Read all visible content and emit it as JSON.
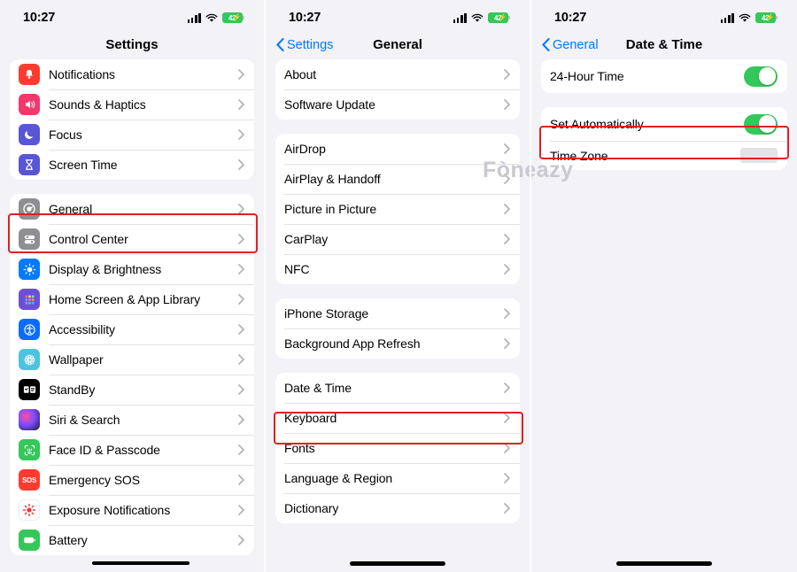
{
  "status": {
    "time": "10:27",
    "battery_percent": "42",
    "battery_color": "#34C759",
    "icons": {
      "signal": "cellular-signal-icon",
      "wifi": "wifi-icon",
      "battery": "battery-icon"
    }
  },
  "watermark": {
    "text": "Fòneazy"
  },
  "accent": {
    "blue": "#007AFF",
    "green": "#34C759",
    "highlight_red": "#E02020"
  },
  "panels": [
    {
      "id": "settings",
      "nav": {
        "back": "",
        "title": "Settings"
      },
      "groups": [
        {
          "rows": [
            {
              "label": "Notifications",
              "icon": "notifications-bell-icon",
              "color": "#FF3B30"
            },
            {
              "label": "Sounds & Haptics",
              "icon": "speaker-sound-icon",
              "color": "#F4386B"
            },
            {
              "label": "Focus",
              "icon": "focus-moon-icon",
              "color": "#5856D6"
            },
            {
              "label": "Screen Time",
              "icon": "screen-time-hourglass-icon",
              "color": "#5856D6"
            }
          ]
        },
        {
          "rows": [
            {
              "label": "General",
              "icon": "general-gear-icon",
              "color": "#8E8E93",
              "highlighted": true
            },
            {
              "label": "Control Center",
              "icon": "control-center-icon",
              "color": "#8E8E93"
            },
            {
              "label": "Display & Brightness",
              "icon": "display-brightness-icon",
              "color": "#007AFF"
            },
            {
              "label": "Home Screen & App Library",
              "icon": "home-screen-grid-icon",
              "color": "#6B4FD8"
            },
            {
              "label": "Accessibility",
              "icon": "accessibility-icon",
              "color": "#0A6CFF"
            },
            {
              "label": "Wallpaper",
              "icon": "wallpaper-flower-icon",
              "color": "#4EC3E0"
            },
            {
              "label": "StandBy",
              "icon": "standby-icon",
              "color": "#000000"
            },
            {
              "label": "Siri & Search",
              "icon": "siri-icon",
              "color": "#2B2B3A"
            },
            {
              "label": "Face ID & Passcode",
              "icon": "face-id-icon",
              "color": "#34C759"
            },
            {
              "label": "Emergency SOS",
              "icon": "emergency-sos-icon",
              "color": "#FF3B30"
            },
            {
              "label": "Exposure Notifications",
              "icon": "exposure-notifications-icon",
              "color": "#FFFFFF"
            },
            {
              "label": "Battery",
              "icon": "battery-green-icon",
              "color": "#34C759"
            }
          ]
        }
      ]
    },
    {
      "id": "general",
      "nav": {
        "back": "Settings",
        "title": "General"
      },
      "groups": [
        {
          "rows": [
            {
              "label": "About"
            },
            {
              "label": "Software Update"
            }
          ]
        },
        {
          "rows": [
            {
              "label": "AirDrop"
            },
            {
              "label": "AirPlay & Handoff"
            },
            {
              "label": "Picture in Picture"
            },
            {
              "label": "CarPlay"
            },
            {
              "label": "NFC"
            }
          ]
        },
        {
          "rows": [
            {
              "label": "iPhone Storage"
            },
            {
              "label": "Background App Refresh"
            }
          ]
        },
        {
          "rows": [
            {
              "label": "Date & Time",
              "highlighted": true
            },
            {
              "label": "Keyboard"
            },
            {
              "label": "Fonts"
            },
            {
              "label": "Language & Region"
            },
            {
              "label": "Dictionary"
            }
          ]
        }
      ]
    },
    {
      "id": "date-time",
      "nav": {
        "back": "General",
        "title": "Date & Time"
      },
      "groups": [
        {
          "rows": [
            {
              "label": "24-Hour Time",
              "control": "toggle",
              "toggle_on": true
            }
          ]
        },
        {
          "rows": [
            {
              "label": "Set Automatically",
              "control": "toggle",
              "toggle_on": true,
              "highlighted": true
            },
            {
              "label": "Time Zone",
              "control": "redacted-value"
            }
          ]
        }
      ]
    }
  ]
}
